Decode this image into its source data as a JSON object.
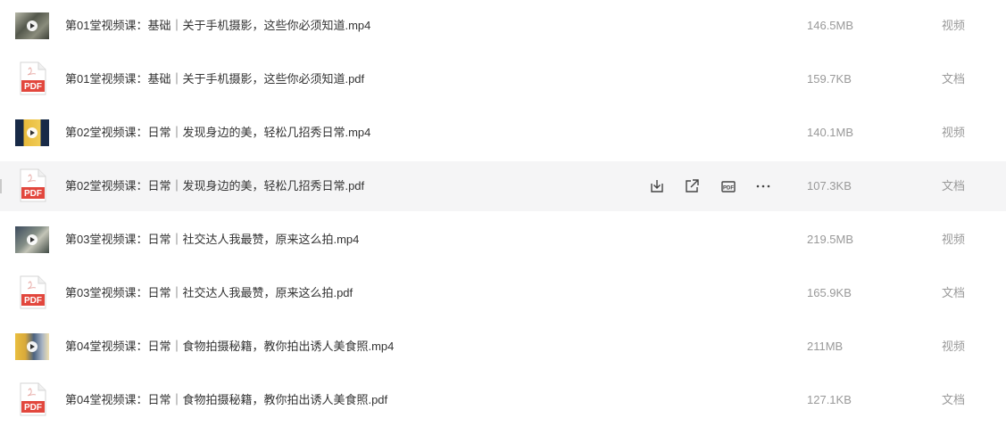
{
  "files": [
    {
      "name": "第01堂视频课：基础｜关于手机摄影，这些你必须知道.mp4",
      "size": "146.5MB",
      "type": "视频",
      "kind": "video",
      "thumb": "vt-a"
    },
    {
      "name": "第01堂视频课：基础｜关于手机摄影，这些你必须知道.pdf",
      "size": "159.7KB",
      "type": "文档",
      "kind": "pdf"
    },
    {
      "name": "第02堂视频课：日常｜发现身边的美，轻松几招秀日常.mp4",
      "size": "140.1MB",
      "type": "视频",
      "kind": "video",
      "thumb": "vt-b"
    },
    {
      "name": "第02堂视频课：日常｜发现身边的美，轻松几招秀日常.pdf",
      "size": "107.3KB",
      "type": "文档",
      "kind": "pdf",
      "hovered": true
    },
    {
      "name": "第03堂视频课：日常｜社交达人我最赞，原来这么拍.mp4",
      "size": "219.5MB",
      "type": "视频",
      "kind": "video",
      "thumb": "vt-c"
    },
    {
      "name": "第03堂视频课：日常｜社交达人我最赞，原来这么拍.pdf",
      "size": "165.9KB",
      "type": "文档",
      "kind": "pdf"
    },
    {
      "name": "第04堂视频课：日常｜食物拍摄秘籍，教你拍出诱人美食照.mp4",
      "size": "211MB",
      "type": "视频",
      "kind": "video",
      "thumb": "vt-d"
    },
    {
      "name": "第04堂视频课：日常｜食物拍摄秘籍，教你拍出诱人美食照.pdf",
      "size": "127.1KB",
      "type": "文档",
      "kind": "pdf"
    }
  ],
  "pdf_icon_label": "PDF",
  "row_actions": {
    "pdf_badge_label": "PDF",
    "icons": [
      "download-icon",
      "share-icon",
      "pdf-convert-icon",
      "more-icon"
    ]
  },
  "colors": {
    "pdf_red": "#e2473d",
    "text": "#333333",
    "muted": "#999999",
    "hover_bg": "#f5f5f6"
  }
}
